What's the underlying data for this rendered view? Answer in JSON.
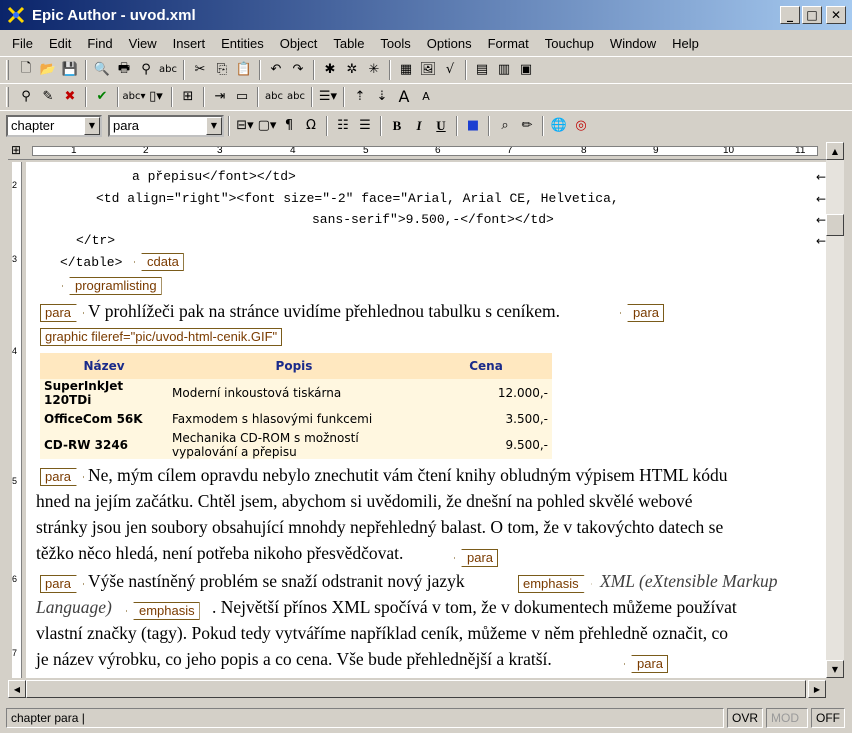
{
  "window": {
    "title": "Epic Author - uvod.xml"
  },
  "window_buttons": {
    "minimize": "_",
    "maximize": "□",
    "close": "✕"
  },
  "menu": [
    "File",
    "Edit",
    "Find",
    "View",
    "Insert",
    "Entities",
    "Object",
    "Table",
    "Tools",
    "Options",
    "Format",
    "Touchup",
    "Window",
    "Help"
  ],
  "toolbar3": {
    "element_combo": "chapter",
    "tag_combo": "para",
    "pilcrow": "¶",
    "omega": "Ω",
    "bold": "B",
    "italic": "I",
    "underline": "U"
  },
  "ruler": [
    "1",
    "2",
    "3",
    "4",
    "5",
    "6",
    "7",
    "8",
    "9",
    "10",
    "11"
  ],
  "vruler": [
    "2",
    "3",
    "4",
    "5",
    "6",
    "7"
  ],
  "code_lines": [
    "a přepisu</font></td>",
    "<td align=\"right\"><font size=\"-2\" face=\"Arial, Arial CE, Helvetica,",
    "sans-serif\">9.500,-</font></td>",
    "</tr>",
    "</table>"
  ],
  "return_mark": "←",
  "tags": {
    "cdata": "cdata",
    "programlisting": "programlisting",
    "para": "para",
    "graphic": "graphic fileref=\"pic/uvod-html-cenik.GIF\"",
    "emphasis": "emphasis"
  },
  "paragraphs": {
    "p1": "V prohlížeči pak na stránce uvidíme přehlednou tabulku s ceníkem.",
    "p2": [
      "Ne, mým cílem opravdu nebylo znechutit vám čtení knihy obludným výpisem HTML kódu",
      "hned na jejím začátku. Chtěl jsem, abychom si uvědomili, že dnešní na pohled skvělé webové",
      "stránky jsou jen soubory obsahující mnohdy nepřehledný balast. O tom, že v takovýchto datech se",
      "těžko něco hledá, není potřeba nikoho přesvědčovat."
    ],
    "p3_start": "Výše nastíněný problém se snaží odstranit nový jazyk",
    "p3_emph1": "XML (eXtensible Markup",
    "p3_emph2": "Language)",
    "p3_rest1": ". Největší přínos XML spočívá v tom, že v dokumentech můžeme používat",
    "p3_rest2": "vlastní značky (tagy). Pokud tedy vytváříme například ceník, můžeme v něm přehledně označit, co",
    "p3_rest3": "je název výrobku, co jeho popis a co cena. Vše bude přehlednější a kratší."
  },
  "price_table": {
    "headers": [
      "Název",
      "Popis",
      "Cena"
    ],
    "rows": [
      [
        "SuperInkJet 120TDi",
        "Moderní inkoustová tiskárna",
        "12.000,-"
      ],
      [
        "OfficeCom 56K",
        "Faxmodem s hlasovými funkcemi",
        "3.500,-"
      ],
      [
        "CD-RW 3246",
        "Mechanika CD-ROM s možností vypalování a přepisu",
        "9.500,-"
      ]
    ]
  },
  "status": {
    "path": "chapter para |",
    "ovr": "OVR",
    "mod": "MOD",
    "off": "OFF"
  },
  "colors": {
    "title_start": "#0a246a",
    "title_end": "#a6caf0",
    "tag_border": "#7a5b1a",
    "table_header": "#ffe8c0",
    "table_body": "#fff7e0"
  }
}
